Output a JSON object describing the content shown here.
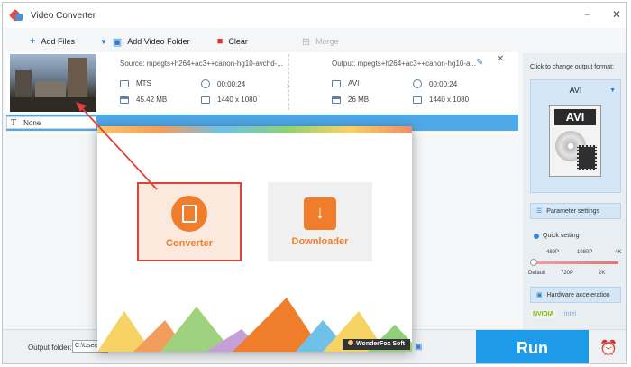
{
  "window": {
    "title": "Video Converter",
    "controls": [
      "−",
      "✕"
    ]
  },
  "toolbar": {
    "add_files": "Add Files",
    "add_video_folder": "Add Video Folder",
    "clear": "Clear",
    "merge": "Merge"
  },
  "task": {
    "source": "Source: mpegts+h264+ac3++canon-hg10-avchd-...",
    "output": "Output: mpegts+h264+ac3++canon-hg10-a...",
    "src_format": "MTS",
    "src_duration": "00:00:24",
    "src_size": "45.42 MB",
    "src_resolution": "1440 x 1080",
    "out_format": "AVI",
    "out_duration": "00:00:24",
    "out_size": "26 MB",
    "out_resolution": "1440 x 1080",
    "subtitle": "None"
  },
  "right_panel": {
    "label": "Click to change output format:",
    "format": "AVI",
    "format_icon_text": "AVI",
    "parameter_settings": "Parameter settings",
    "quick_setting": "Quick setting",
    "q_top": [
      "480P",
      "1080P",
      "4K"
    ],
    "q_bottom": [
      "Default",
      "720P",
      "2K"
    ],
    "hardware_acceleration": "Hardware acceleration",
    "nvidia": "NVIDIA",
    "intel": "Intel"
  },
  "bottom": {
    "output_folder_label": "Output folder:",
    "output_folder_value": "C:\\Users\\",
    "run": "Run"
  },
  "popup": {
    "converter": "Converter",
    "downloader": "Downloader",
    "brand": "WonderFox Soft"
  },
  "colors": {
    "accent": "#1e9be8",
    "orange": "#f07d2c",
    "highlight_border": "#e2413a"
  }
}
